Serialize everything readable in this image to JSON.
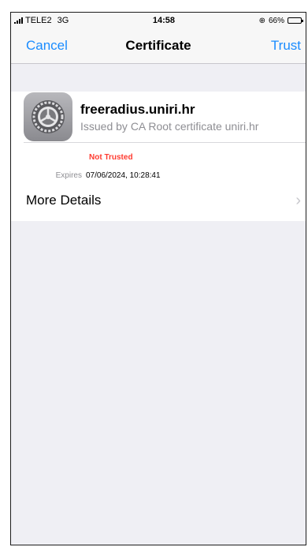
{
  "status_bar": {
    "carrier": "TELE2",
    "network": "3G",
    "time": "14:58",
    "battery_percent": "66%",
    "battery_level": 0.66
  },
  "nav": {
    "cancel_label": "Cancel",
    "title": "Certificate",
    "trust_label": "Trust",
    "accent_color": "#1a8cff"
  },
  "certificate": {
    "icon": "settings-gear-icon",
    "name": "freeradius.uniri.hr",
    "issuer": "Issued by CA Root certificate uniri.hr",
    "status": "Not Trusted",
    "status_color": "#ff3b30",
    "expires_label": "Expires",
    "expires_value": "07/06/2024, 10:28:41"
  },
  "more_details": {
    "label": "More Details",
    "icon": "chevron-right-icon"
  }
}
